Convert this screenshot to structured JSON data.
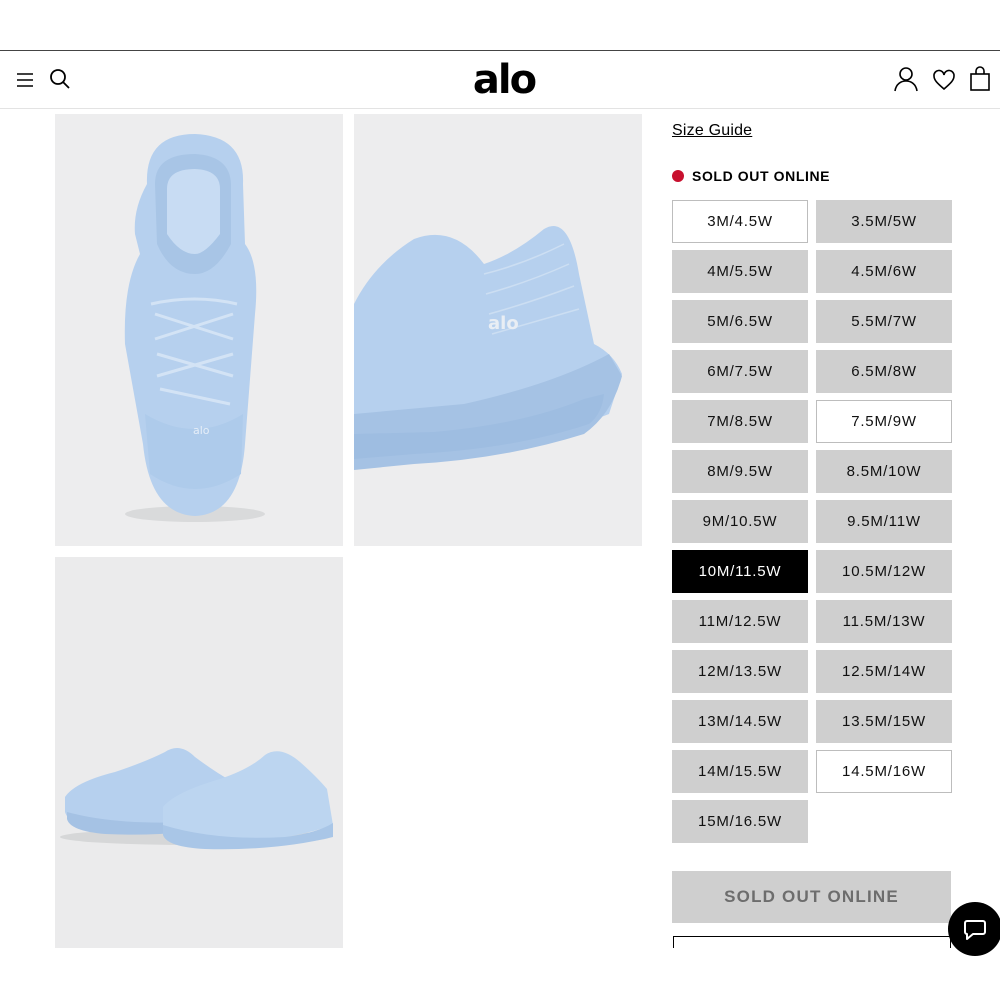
{
  "header": {
    "logo": "alo",
    "icons": {
      "menu": "menu-icon",
      "search": "search-icon",
      "account": "account-icon",
      "wishlist": "heart-icon",
      "bag": "shopping-bag-icon"
    }
  },
  "gallery": {
    "images": [
      "shoe-top-view",
      "shoe-heel-closeup",
      "shoe-pair-side-view"
    ],
    "shoe_color": "#b9d3ef"
  },
  "product": {
    "size_guide": "Size Guide",
    "stock_status": "SOLD OUT ONLINE",
    "sizes": [
      {
        "label": "3M/4.5W",
        "state": "available"
      },
      {
        "label": "3.5M/5W",
        "state": "sold-out"
      },
      {
        "label": "4M/5.5W",
        "state": "sold-out"
      },
      {
        "label": "4.5M/6W",
        "state": "sold-out"
      },
      {
        "label": "5M/6.5W",
        "state": "sold-out"
      },
      {
        "label": "5.5M/7W",
        "state": "sold-out"
      },
      {
        "label": "6M/7.5W",
        "state": "sold-out"
      },
      {
        "label": "6.5M/8W",
        "state": "sold-out"
      },
      {
        "label": "7M/8.5W",
        "state": "sold-out"
      },
      {
        "label": "7.5M/9W",
        "state": "available"
      },
      {
        "label": "8M/9.5W",
        "state": "sold-out"
      },
      {
        "label": "8.5M/10W",
        "state": "sold-out"
      },
      {
        "label": "9M/10.5W",
        "state": "sold-out"
      },
      {
        "label": "9.5M/11W",
        "state": "sold-out"
      },
      {
        "label": "10M/11.5W",
        "state": "selected"
      },
      {
        "label": "10.5M/12W",
        "state": "sold-out"
      },
      {
        "label": "11M/12.5W",
        "state": "sold-out"
      },
      {
        "label": "11.5M/13W",
        "state": "sold-out"
      },
      {
        "label": "12M/13.5W",
        "state": "sold-out"
      },
      {
        "label": "12.5M/14W",
        "state": "sold-out"
      },
      {
        "label": "13M/14.5W",
        "state": "sold-out"
      },
      {
        "label": "13.5M/15W",
        "state": "sold-out"
      },
      {
        "label": "14M/15.5W",
        "state": "sold-out"
      },
      {
        "label": "14.5M/16W",
        "state": "available"
      },
      {
        "label": "15M/16.5W",
        "state": "sold-out"
      }
    ],
    "primary_button": "SOLD OUT ONLINE"
  },
  "colors": {
    "sold_out_red": "#c8102e",
    "size_sold_out_bg": "#cfcfcf",
    "size_selected_bg": "#000000"
  },
  "chat": {
    "icon": "chat-icon"
  }
}
